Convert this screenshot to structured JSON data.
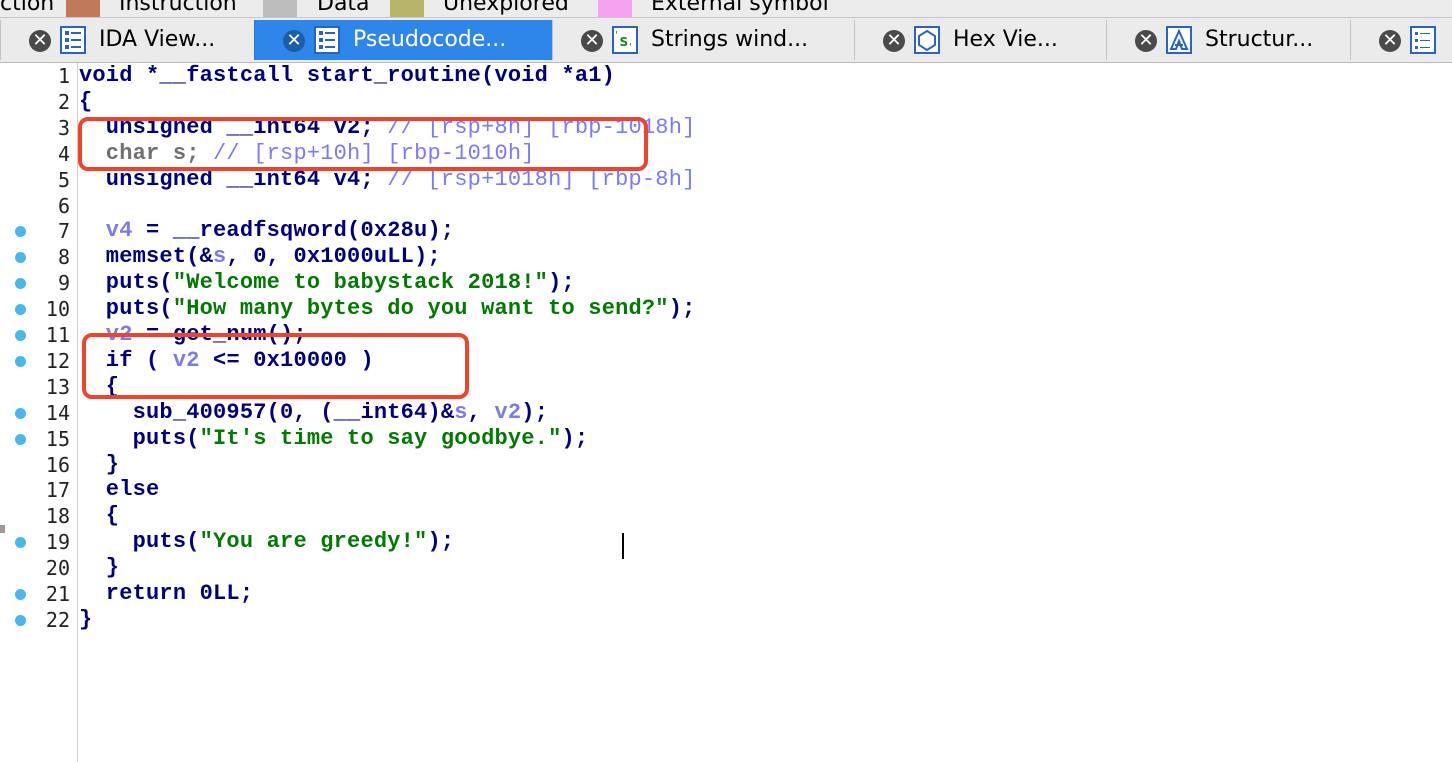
{
  "legend": [
    {
      "label": "ction",
      "color": ""
    },
    {
      "label": "Instruction",
      "color": "#c07a5a"
    },
    {
      "label": "Data",
      "color": "#bdbdbd"
    },
    {
      "label": "Unexplored",
      "color": "#b8b46a"
    },
    {
      "label": "External symbol",
      "color": "#f6a2f0"
    }
  ],
  "tabs": [
    {
      "label": "IDA View...",
      "icon": "ida-view-icon",
      "active": false
    },
    {
      "label": "Pseudocode...",
      "icon": "pseudocode-icon",
      "active": true
    },
    {
      "label": "Strings wind...",
      "icon": "strings-icon",
      "active": false
    },
    {
      "label": "Hex Vie...",
      "icon": "hex-view-icon",
      "active": false
    },
    {
      "label": "Structur...",
      "icon": "structures-icon",
      "active": false
    },
    {
      "label": "",
      "icon": "enums-icon",
      "active": false
    }
  ],
  "code": {
    "lines": [
      {
        "n": "1",
        "bp": false,
        "parts": [
          [
            "d",
            "void *__fastcall start_routine(void *a1)"
          ]
        ]
      },
      {
        "n": "2",
        "bp": false,
        "parts": [
          [
            "d",
            "{"
          ]
        ]
      },
      {
        "n": "3",
        "bp": false,
        "parts": [
          [
            "d",
            "  unsigned __int64 v2; "
          ],
          [
            "c",
            "// [rsp+8h] [rbp-1018h]"
          ]
        ]
      },
      {
        "n": "4",
        "bp": false,
        "parts": [
          [
            "g",
            "  char s; "
          ],
          [
            "c",
            "// [rsp+10h] [rbp-1010h]"
          ]
        ]
      },
      {
        "n": "5",
        "bp": false,
        "parts": [
          [
            "d",
            "  unsigned __int64 v4; "
          ],
          [
            "c",
            "// [rsp+1018h] [rbp-8h]"
          ]
        ]
      },
      {
        "n": "6",
        "bp": false,
        "parts": []
      },
      {
        "n": "7",
        "bp": true,
        "parts": [
          [
            "v",
            "  v4"
          ],
          [
            "d",
            " = __readfsqword(0x28u);"
          ]
        ]
      },
      {
        "n": "8",
        "bp": true,
        "parts": [
          [
            "d",
            "  memset(&"
          ],
          [
            "v",
            "s"
          ],
          [
            "d",
            ", 0, 0x1000uLL);"
          ]
        ]
      },
      {
        "n": "9",
        "bp": true,
        "parts": [
          [
            "d",
            "  puts("
          ],
          [
            "s",
            "\"Welcome to babystack 2018!\""
          ],
          [
            "d",
            ");"
          ]
        ]
      },
      {
        "n": "10",
        "bp": true,
        "parts": [
          [
            "d",
            "  puts("
          ],
          [
            "s",
            "\"How many bytes do you want to send?\""
          ],
          [
            "d",
            ");"
          ]
        ]
      },
      {
        "n": "11",
        "bp": true,
        "parts": [
          [
            "v",
            "  v2"
          ],
          [
            "d",
            " = get_num();"
          ]
        ]
      },
      {
        "n": "12",
        "bp": true,
        "parts": [
          [
            "d",
            "  if ( "
          ],
          [
            "v",
            "v2"
          ],
          [
            "d",
            " <= 0x10000 )"
          ]
        ]
      },
      {
        "n": "13",
        "bp": false,
        "parts": [
          [
            "d",
            "  {"
          ]
        ]
      },
      {
        "n": "14",
        "bp": true,
        "parts": [
          [
            "d",
            "    sub_400957(0, (__int64)&"
          ],
          [
            "v",
            "s"
          ],
          [
            "d",
            ", "
          ],
          [
            "v",
            "v2"
          ],
          [
            "d",
            ");"
          ]
        ]
      },
      {
        "n": "15",
        "bp": true,
        "parts": [
          [
            "d",
            "    puts("
          ],
          [
            "s",
            "\"It's time to say goodbye.\""
          ],
          [
            "d",
            ");"
          ]
        ]
      },
      {
        "n": "16",
        "bp": false,
        "parts": [
          [
            "d",
            "  }"
          ]
        ]
      },
      {
        "n": "17",
        "bp": false,
        "parts": [
          [
            "d",
            "  else"
          ]
        ]
      },
      {
        "n": "18",
        "bp": false,
        "parts": [
          [
            "d",
            "  {"
          ]
        ]
      },
      {
        "n": "19",
        "bp": true,
        "parts": [
          [
            "d",
            "    puts("
          ],
          [
            "s",
            "\"You are greedy!\""
          ],
          [
            "d",
            ");"
          ]
        ]
      },
      {
        "n": "20",
        "bp": false,
        "parts": [
          [
            "d",
            "  }"
          ]
        ]
      },
      {
        "n": "21",
        "bp": true,
        "parts": [
          [
            "d",
            "  return 0LL;"
          ]
        ]
      },
      {
        "n": "22",
        "bp": true,
        "parts": [
          [
            "d",
            "}"
          ]
        ]
      }
    ]
  },
  "colors": {
    "default": "#00007f",
    "variable": "#7b7bea",
    "string": "#007a00",
    "comment": "#7a7aff",
    "dimmed": "#707070",
    "highlight": "#f0432a",
    "active_tab": "#2f86ea",
    "breakpoint": "#48b7ee"
  }
}
